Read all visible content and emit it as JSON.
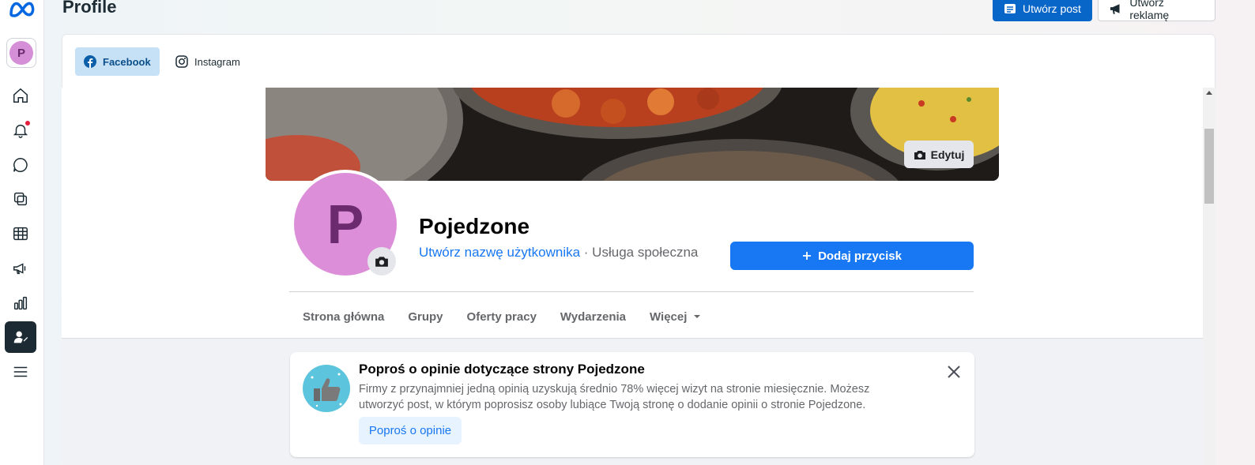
{
  "header": {
    "title": "Profile",
    "create_post_label": "Utwórz post",
    "create_ad_label": "Utwórz reklamę"
  },
  "rail": {
    "avatar_letter": "P",
    "items": [
      "home",
      "notifications",
      "messages",
      "content",
      "planner",
      "ads",
      "insights",
      "profile",
      "menu"
    ]
  },
  "platform_tabs": [
    {
      "label": "Facebook",
      "selected": true
    },
    {
      "label": "Instagram",
      "selected": false
    }
  ],
  "profile": {
    "cover_edit_label": "Edytuj",
    "avatar_letter": "P",
    "name": "Pojedzone",
    "username_link": "Utwórz nazwę użytkownika",
    "category": " · Usługa społeczna",
    "add_button_label": "Dodaj przycisk",
    "nav": [
      "Strona główna",
      "Grupy",
      "Oferty pracy",
      "Wydarzenia",
      "Więcej"
    ]
  },
  "promo": {
    "title": "Poproś o opinie dotyczące strony Pojedzone",
    "text": "Firmy z przynajmniej jedną opinią uzyskują średnio 78% więcej wizyt na stronie miesięcznie. Możesz utworzyć post, w którym poprosisz osoby lubiące Twoją stronę o dodanie opinii o stronie Pojedzone.",
    "button_label": "Poproś o opinie"
  },
  "colors": {
    "primary_blue": "#1877f2",
    "avatar_pink": "#dc8fd8",
    "rail_active": "#1c2b33"
  }
}
